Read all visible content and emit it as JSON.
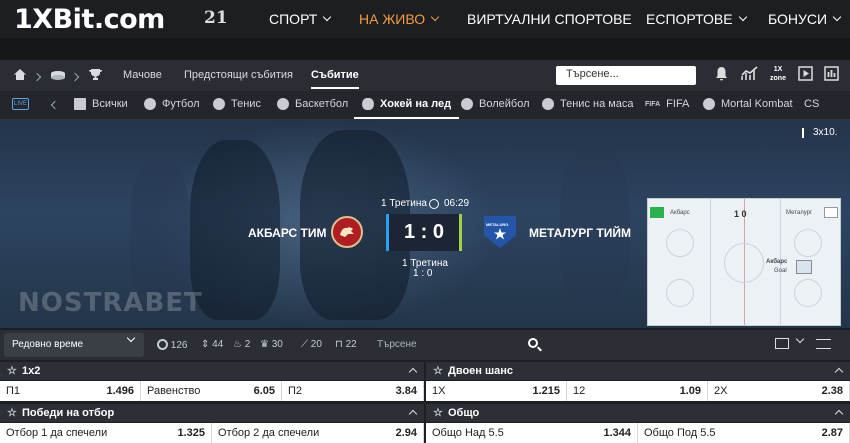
{
  "header": {
    "logo": "1XBit.com",
    "years": "21",
    "nav": [
      {
        "label": "СПОРТ",
        "dropdown": true
      },
      {
        "label": "НА ЖИВО",
        "dropdown": true,
        "active": true
      },
      {
        "label": "ВИРТУАЛНИ СПОРТОВЕ",
        "dropdown": false
      },
      {
        "label": "ЕСПОРТОВЕ",
        "dropdown": true
      },
      {
        "label": "БОНУСИ",
        "dropdown": true
      }
    ],
    "accent_color": "#f39c3a"
  },
  "breadcrumb": {
    "links": [
      "Мачове",
      "Предстоящи събития",
      "Събитие"
    ],
    "search_placeholder": "Търсене...",
    "zone_label": "1X zone"
  },
  "sports_tabs": {
    "live_label": "LIVE",
    "tabs": [
      "Всички",
      "Футбол",
      "Тенис",
      "Баскетбол",
      "Хокей на лед",
      "Волейбол",
      "Тенис на маса",
      "FIFA",
      "Mortal Kombat",
      "CS"
    ],
    "fifa_badge": "FIFA",
    "active": "Хокей на лед"
  },
  "scoreboard": {
    "period": "1 Третина",
    "clock": "06:29",
    "team1": "АКБАРС ТИМ",
    "team2": "МЕТАЛУРГ ТИЙМ",
    "score": "1 : 0",
    "period_label": "1 Третина",
    "period_score": "1 : 0",
    "watermark": "NOSTRABET",
    "format": "3x10.",
    "team2_badge_text": "METALURG",
    "rink": {
      "team1": "Акбарс",
      "team2": "Металург",
      "score": "1 0",
      "event_team": "Акбарс",
      "event": "Goal"
    }
  },
  "filters": {
    "period_select": "Редовно време",
    "counts": [
      "126",
      "44",
      "2",
      "30",
      "20",
      "22"
    ],
    "search_placeholder": "Търсене"
  },
  "markets": [
    {
      "title": "1x2",
      "outcomes": [
        {
          "label": "П1",
          "odds": "1.496"
        },
        {
          "label": "Равенство",
          "odds": "6.05"
        },
        {
          "label": "П2",
          "odds": "3.84"
        }
      ]
    },
    {
      "title": "Двоен шанс",
      "outcomes": [
        {
          "label": "1X",
          "odds": "1.215"
        },
        {
          "label": "12",
          "odds": "1.09"
        },
        {
          "label": "2X",
          "odds": "2.38"
        }
      ]
    },
    {
      "title": "Победи на отбор",
      "outcomes": [
        {
          "label": "Отбор 1 да спечели",
          "odds": "1.325"
        },
        {
          "label": "Отбор 2 да спечели",
          "odds": "2.94"
        }
      ]
    },
    {
      "title": "Общо",
      "outcomes": [
        {
          "label": "Общо Над 5.5",
          "odds": "1.344"
        },
        {
          "label": "Общо Под 5.5",
          "odds": "2.87"
        }
      ]
    }
  ]
}
